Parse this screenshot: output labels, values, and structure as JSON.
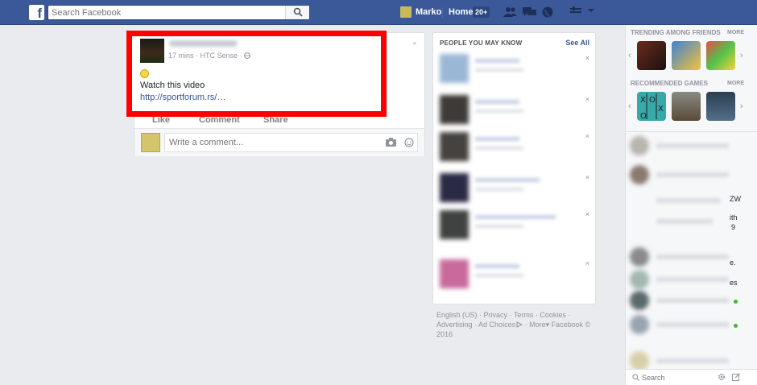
{
  "topbar": {
    "search_placeholder": "Search Facebook",
    "user_name": "Marko",
    "home_label": "Home",
    "home_badge": "20+"
  },
  "post": {
    "meta": "17 mins · HTC Sense ·",
    "text": "Watch this video",
    "link": "http://sportforum.rs/…",
    "like_label": "Like",
    "comment_label": "Comment",
    "share_label": "Share",
    "comment_placeholder": "Write a comment..."
  },
  "pymk": {
    "title": "PEOPLE YOU MAY KNOW",
    "see_all": "See All",
    "dismiss": "×"
  },
  "footer": {
    "links": [
      "English (US)",
      "Privacy",
      "Terms",
      "Cookies",
      "Advertising",
      "Ad Choices",
      "More"
    ],
    "copyright": "Facebook © 2016"
  },
  "sidebar": {
    "trending_title": "TRENDING AMONG FRIENDS",
    "trending_more": "MORE",
    "recommended_title": "RECOMMENDED GAMES",
    "recommended_more": "MORE",
    "chat_search_placeholder": "Search",
    "partial_text": [
      "ZW",
      "ith",
      "9",
      "e.",
      "es"
    ]
  },
  "colors": {
    "brand": "#3b5998",
    "highlight": "#ff0000",
    "link": "#365899",
    "online": "#42b72a"
  }
}
